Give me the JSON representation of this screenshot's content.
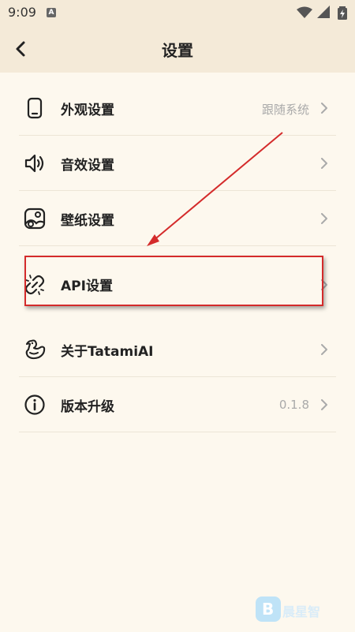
{
  "status_bar": {
    "time": "9:09",
    "notification_badge": "A",
    "icons": [
      "wifi-icon",
      "signal-icon",
      "battery-icon"
    ]
  },
  "header": {
    "title": "设置",
    "back_icon": "back-arrow-icon"
  },
  "settings": [
    {
      "label": "外观设置",
      "value": "跟随系统",
      "icon": "phone-icon"
    },
    {
      "label": "音效设置",
      "value": "",
      "icon": "speaker-icon"
    },
    {
      "label": "壁纸设置",
      "value": "",
      "icon": "wallpaper-icon"
    },
    {
      "label": "API设置",
      "value": "",
      "icon": "link-broken-icon"
    },
    {
      "label": "关于TatamiAI",
      "value": "",
      "icon": "duck-icon"
    },
    {
      "label": "版本升级",
      "value": "0.1.8",
      "icon": "info-icon"
    }
  ],
  "annotation": {
    "highlighted_item": "API设置",
    "color": "#d42b2b"
  },
  "watermark": {
    "text": "晨星智"
  },
  "colors": {
    "background": "#fdf8ee",
    "header": "#f4ead8",
    "divider": "#ece5d6",
    "annotation": "#d42b2b"
  }
}
